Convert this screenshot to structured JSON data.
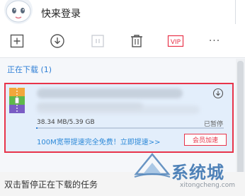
{
  "header": {
    "login_label": "快来登录",
    "avatar_icon": "cartoon-avatar-icon"
  },
  "toolbar": {
    "buttons": [
      {
        "icon": "new-task-icon"
      },
      {
        "icon": "download-icon"
      },
      {
        "icon": "pause-icon",
        "disabled": true
      },
      {
        "icon": "trash-icon"
      },
      {
        "icon": "vip-icon",
        "label": "VIP"
      },
      {
        "icon": "more-icon",
        "label": "···"
      }
    ]
  },
  "section": {
    "title": "正在下载 (1)"
  },
  "download_item": {
    "file_icon": "archive-file-icon",
    "size_text": "38.34 MB/5.39 GB",
    "status_text": "已暂停",
    "progress": 0.007,
    "promo_text": "100M宽带提速完全免费！立即提速>>",
    "vip_speed_label": "会员加速"
  },
  "caption": {
    "text": "双击暂停正在下载的任务"
  },
  "watermark": {
    "name": "系统城",
    "url": "xitongcheng.com"
  },
  "colors": {
    "accent": "#2f7fd6",
    "highlight_border": "#e8344a",
    "item_bg": "#e3eefb"
  }
}
